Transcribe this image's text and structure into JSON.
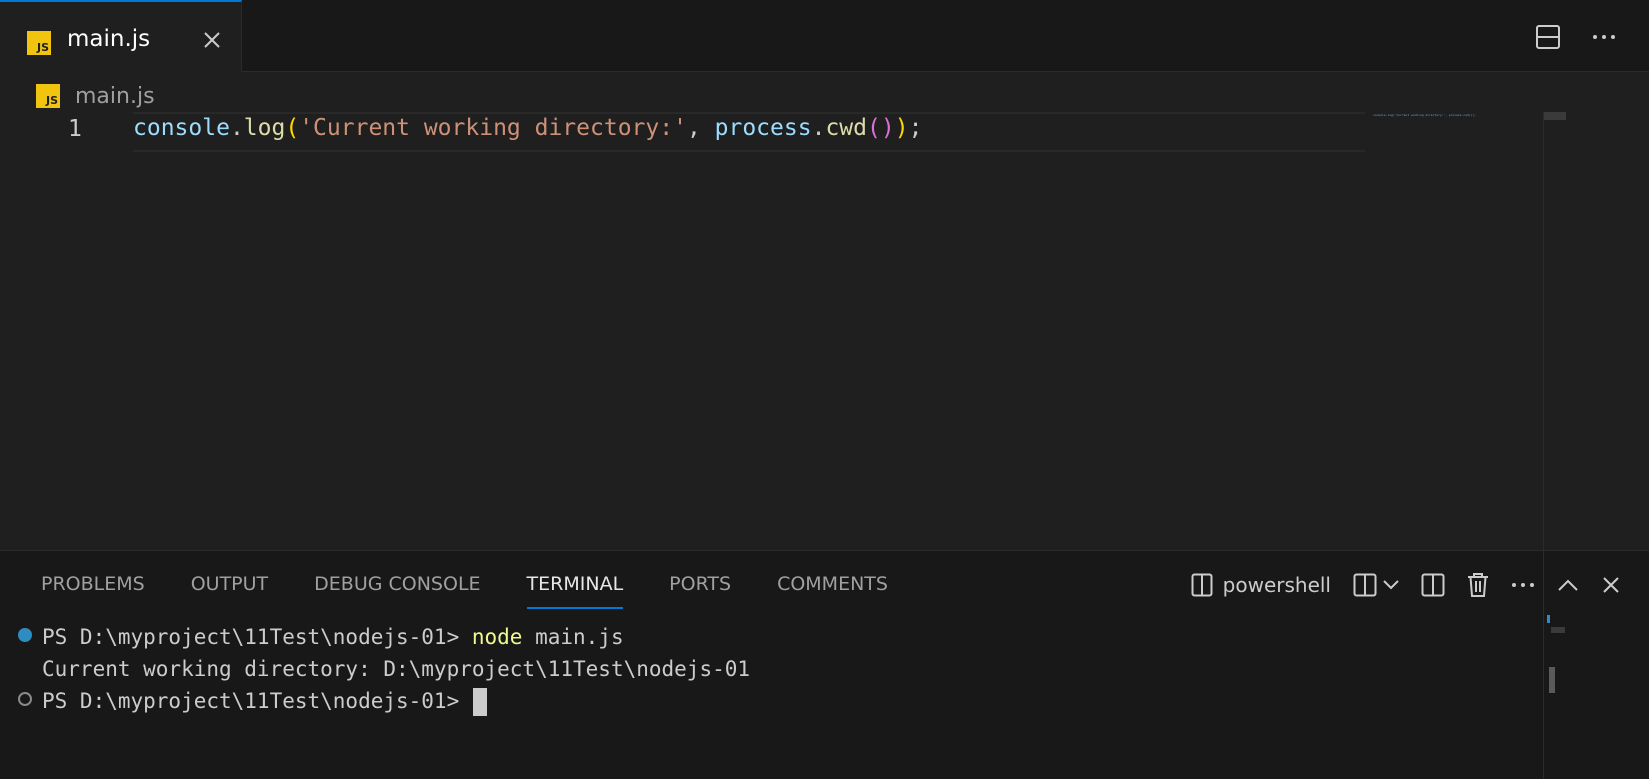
{
  "tab": {
    "label": "main.js",
    "icon_text": "JS",
    "close_icon": "close-icon"
  },
  "editor_actions": {
    "split_icon": "split-editor-icon",
    "more_icon": "more-actions-icon"
  },
  "breadcrumb": {
    "icon_text": "JS",
    "label": "main.js"
  },
  "editor": {
    "line_number": "1",
    "code": {
      "t1": "console",
      "t2": ".",
      "t3": "log",
      "t4": "(",
      "t5": "'Current working directory:'",
      "t6": ", ",
      "t7": "process",
      "t8": ".",
      "t9": "cwd",
      "t10": "(",
      "t11": ")",
      "t12": ")",
      "t13": ";"
    },
    "minimap_text": "console.log('Current working directory:', process.cwd());"
  },
  "panel": {
    "tabs": [
      "PROBLEMS",
      "OUTPUT",
      "DEBUG CONSOLE",
      "TERMINAL",
      "PORTS",
      "COMMENTS"
    ],
    "active_tab": "TERMINAL",
    "shell_label": "powershell"
  },
  "terminal": {
    "line1_prompt": "PS D:\\myproject\\11Test\\nodejs-01> ",
    "line1_cmd": "node",
    "line1_args": " main.js",
    "line2": "Current working directory: D:\\myproject\\11Test\\nodejs-01",
    "line3_prompt": "PS D:\\myproject\\11Test\\nodejs-01>"
  },
  "colors": {
    "accent": "#0078d4",
    "js_badge": "#f1c40f",
    "string": "#ce9178",
    "variable": "#9cdcfe",
    "function": "#dcdcaa",
    "command": "#f1fa8c"
  }
}
